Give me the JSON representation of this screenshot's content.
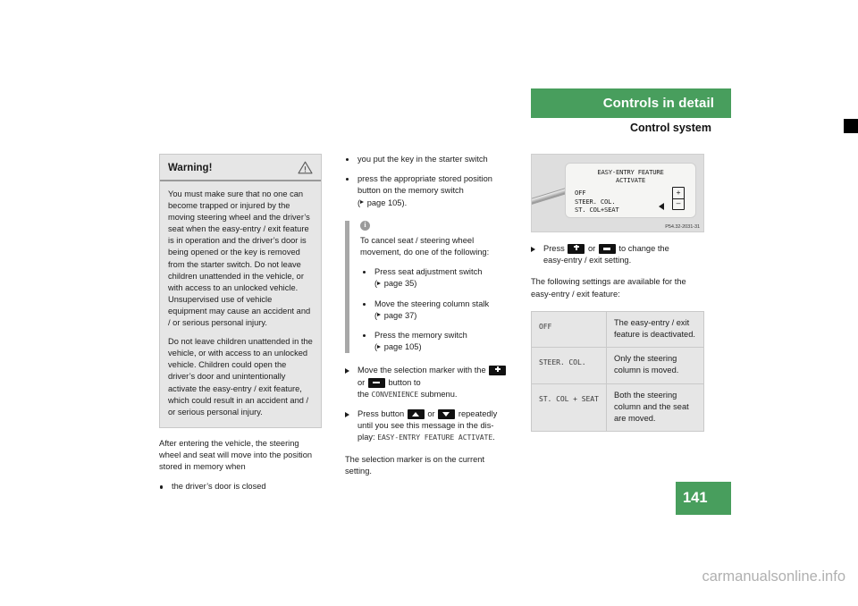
{
  "header": {
    "section_title": "Controls in detail",
    "sub_title": "Control system"
  },
  "page_number": "141",
  "watermark": "carmanualsonline.info",
  "warning_box": {
    "title": "Warning!",
    "icon": "warning-triangle-icon",
    "paragraphs": [
      "You must make sure that no one can become trapped or injured by the moving steering wheel and the driver’s seat when the easy-entry / exit feature is in operation and the driver’s door is being opened or the key is removed from the starter switch. Do not leave children unattended in the vehicle, or with access to an unlocked vehicle. Unsupervised use of vehicle equipment may cause an accident and / or serious personal injury.",
      "Do not leave children unattended in the vehicle, or with access to an unlocked vehicle. Children could open the driver’s door and unintentionally activate the easy-entry / exit feature, which could result in an accident and / or serious personal injury."
    ]
  },
  "left_column": {
    "intro": "After entering the vehicle, the steering wheel and seat will move into the position stored in memory when",
    "bullets": [
      "the driver’s door is closed"
    ]
  },
  "middle_column": {
    "bullets": [
      "you put the key in the starter switch",
      "press the appropriate stored position button on the memory switch"
    ],
    "bullet2_ref": "page 105).",
    "bullet2_ref_open": "(",
    "info": {
      "icon": "info-circle-icon",
      "lead": "To cancel seat / steering wheel movement, do one of the following:",
      "items": [
        {
          "text": "Press seat adjustment switch",
          "ref": "page 35)"
        },
        {
          "text": "Move the steering column stalk",
          "ref": "page 37)"
        },
        {
          "text": "Press the memory switch",
          "ref": "page 105)"
        }
      ]
    },
    "actions": [
      {
        "pre": "Move the selection marker with the",
        "btn1": "plus-button",
        "mid": "or",
        "btn2": "minus-button",
        "post": "button to",
        "line3_pre": "the",
        "line3_mono": "CONVENIENCE",
        "line3_post": "submenu."
      },
      {
        "pre": "Press button",
        "btn1": "up-button",
        "mid": "or",
        "btn2": "down-button",
        "post": "repeatedly",
        "line2": "until you see this message in the dis-",
        "line3_pre": "play:",
        "line3_mono": "EASY-ENTRY FEATURE ACTIVATE",
        "line3_post": "."
      }
    ],
    "closing": "The selection marker is on the current setting."
  },
  "right_column": {
    "illustration": {
      "name": "easy-entry-feature-display-illustration",
      "screen_title_line1": "EASY-ENTRY FEATURE",
      "screen_title_line2": "ACTIVATE",
      "screen_options": [
        "OFF",
        "STEER. COL.",
        "ST. COL+SEAT"
      ],
      "selection_marker": "left-pointing-triangle",
      "plus_symbol": "+",
      "minus_symbol": "–",
      "code": "P54.32-2031-31"
    },
    "action": {
      "pre": "Press",
      "btn1": "plus-button",
      "mid": "or",
      "btn2": "minus-button",
      "post": "to change the",
      "line2": "easy-entry / exit setting."
    },
    "table_intro": "The following settings are available for the easy-entry / exit feature:",
    "table": {
      "rows": [
        {
          "key": "OFF",
          "value": "The easy-entry / exit feature is deactivated."
        },
        {
          "key": "STEER. COL.",
          "value": "Only the steering column is moved."
        },
        {
          "key": "ST. COL + SEAT",
          "value": "Both the steering column and the seat are moved."
        }
      ]
    }
  }
}
